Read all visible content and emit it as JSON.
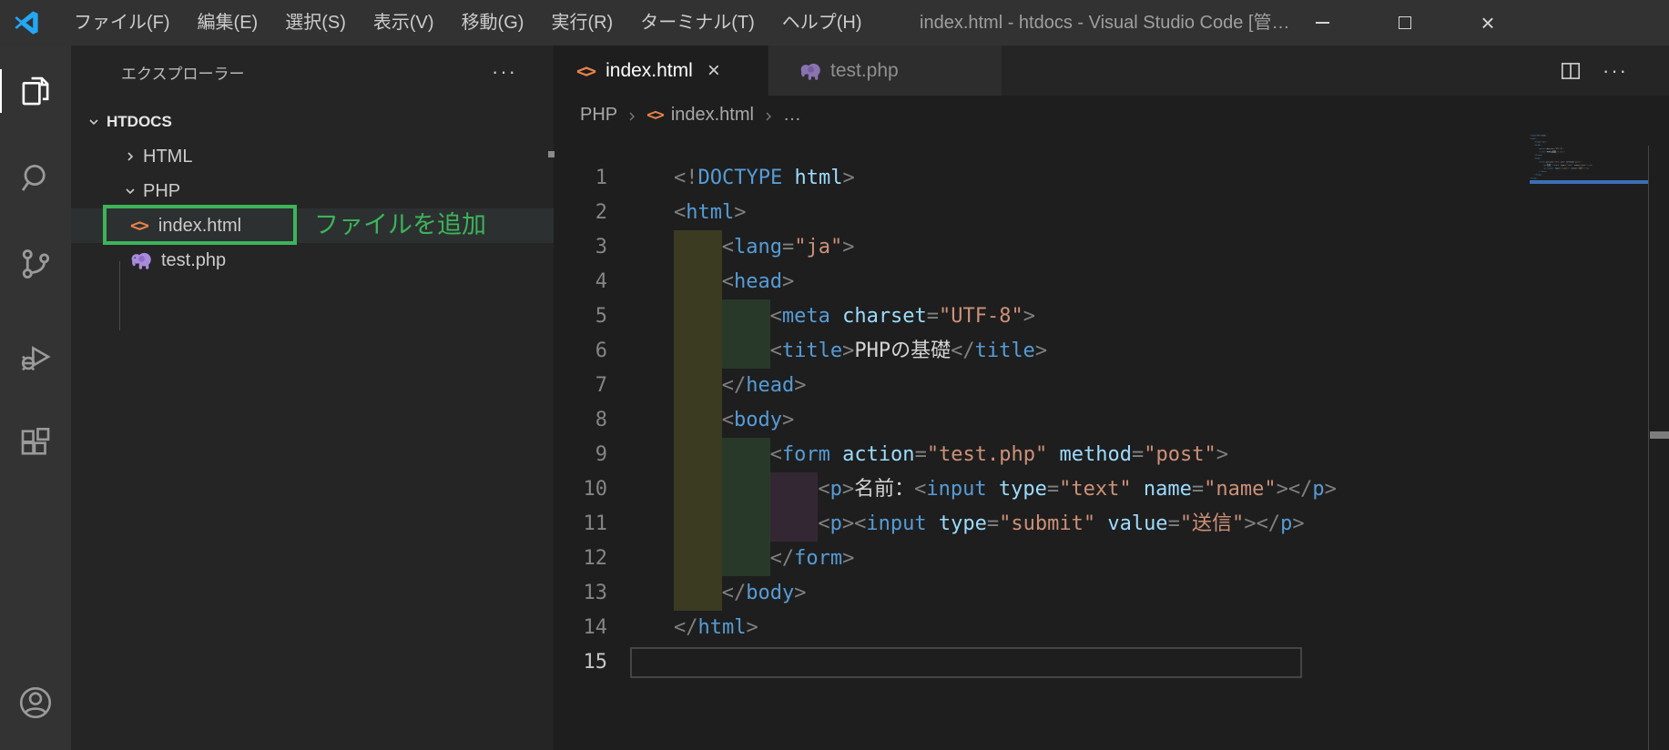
{
  "window": {
    "menus": [
      "ファイル(F)",
      "編集(E)",
      "選択(S)",
      "表示(V)",
      "移動(G)",
      "実行(R)",
      "ターミナル(T)",
      "ヘルプ(H)"
    ],
    "title": "index.html - htdocs - Visual Studio Code [管…",
    "controls": {
      "close": "×"
    }
  },
  "activity_bar": {
    "items": [
      "explorer",
      "search",
      "source-control",
      "run-and-debug",
      "extensions"
    ],
    "account": "accounts"
  },
  "sidebar": {
    "header": {
      "title": "エクスプローラー",
      "more": "···"
    },
    "tree": {
      "root": {
        "label": "HTDOCS"
      },
      "items": [
        {
          "label": "HTML",
          "type": "folder",
          "state": "collapsed"
        },
        {
          "label": "PHP",
          "type": "folder",
          "state": "expanded"
        },
        {
          "label": "index.html",
          "type": "file-html",
          "selected": true,
          "annotated": true
        },
        {
          "label": "test.php",
          "type": "file-php",
          "selected": false
        }
      ]
    },
    "annotation": {
      "label": "ファイルを追加",
      "color": "#3cb45a"
    }
  },
  "editor": {
    "tabs": [
      {
        "label": "index.html",
        "icon": "html",
        "active": true,
        "close": "×"
      },
      {
        "label": "test.php",
        "icon": "php",
        "active": false
      }
    ],
    "actions": {
      "more": "···"
    },
    "breadcrumb": {
      "folder": "PHP",
      "file": "index.html",
      "more": "…"
    },
    "code": {
      "language": "html",
      "colors": {
        "tag": "#569cd6",
        "attribute": "#9cdcfe",
        "string": "#ce9178",
        "text": "#d4d4d4",
        "punctuation": "#808080"
      },
      "lines": [
        {
          "n": 1,
          "indent": 0,
          "tokens": [
            [
              "p",
              "<!"
            ],
            [
              "t",
              "DOCTYPE"
            ],
            [
              "x",
              " "
            ],
            [
              "a",
              "html"
            ],
            [
              "p",
              ">"
            ]
          ]
        },
        {
          "n": 2,
          "indent": 0,
          "tokens": [
            [
              "p",
              "<"
            ],
            [
              "t",
              "html"
            ],
            [
              "p",
              ">"
            ]
          ]
        },
        {
          "n": 3,
          "indent": 1,
          "tokens": [
            [
              "p",
              "<"
            ],
            [
              "t",
              "lang"
            ],
            [
              "p",
              "="
            ],
            [
              "s",
              "\"ja\""
            ],
            [
              "p",
              ">"
            ]
          ]
        },
        {
          "n": 4,
          "indent": 1,
          "tokens": [
            [
              "p",
              "<"
            ],
            [
              "t",
              "head"
            ],
            [
              "p",
              ">"
            ]
          ]
        },
        {
          "n": 5,
          "indent": 2,
          "tokens": [
            [
              "p",
              "<"
            ],
            [
              "t",
              "meta"
            ],
            [
              "x",
              " "
            ],
            [
              "a",
              "charset"
            ],
            [
              "p",
              "="
            ],
            [
              "s",
              "\"UTF-8\""
            ],
            [
              "p",
              ">"
            ]
          ]
        },
        {
          "n": 6,
          "indent": 2,
          "tokens": [
            [
              "p",
              "<"
            ],
            [
              "t",
              "title"
            ],
            [
              "p",
              ">"
            ],
            [
              "x",
              "PHPの基礎"
            ],
            [
              "p",
              "</"
            ],
            [
              "t",
              "title"
            ],
            [
              "p",
              ">"
            ]
          ]
        },
        {
          "n": 7,
          "indent": 1,
          "tokens": [
            [
              "p",
              "</"
            ],
            [
              "t",
              "head"
            ],
            [
              "p",
              ">"
            ]
          ]
        },
        {
          "n": 8,
          "indent": 1,
          "tokens": [
            [
              "p",
              "<"
            ],
            [
              "t",
              "body"
            ],
            [
              "p",
              ">"
            ]
          ]
        },
        {
          "n": 9,
          "indent": 2,
          "tokens": [
            [
              "p",
              "<"
            ],
            [
              "t",
              "form"
            ],
            [
              "x",
              " "
            ],
            [
              "a",
              "action"
            ],
            [
              "p",
              "="
            ],
            [
              "s",
              "\"test.php\""
            ],
            [
              "x",
              " "
            ],
            [
              "a",
              "method"
            ],
            [
              "p",
              "="
            ],
            [
              "s",
              "\"post\""
            ],
            [
              "p",
              ">"
            ]
          ]
        },
        {
          "n": 10,
          "indent": 3,
          "tokens": [
            [
              "p",
              "<"
            ],
            [
              "t",
              "p"
            ],
            [
              "p",
              ">"
            ],
            [
              "x",
              "名前："
            ],
            [
              "p",
              "<"
            ],
            [
              "t",
              "input"
            ],
            [
              "x",
              " "
            ],
            [
              "a",
              "type"
            ],
            [
              "p",
              "="
            ],
            [
              "s",
              "\"text\""
            ],
            [
              "x",
              " "
            ],
            [
              "a",
              "name"
            ],
            [
              "p",
              "="
            ],
            [
              "s",
              "\"name\""
            ],
            [
              "p",
              ">"
            ],
            [
              "p",
              "</"
            ],
            [
              "t",
              "p"
            ],
            [
              "p",
              ">"
            ]
          ]
        },
        {
          "n": 11,
          "indent": 3,
          "tokens": [
            [
              "p",
              "<"
            ],
            [
              "t",
              "p"
            ],
            [
              "p",
              ">"
            ],
            [
              "p",
              "<"
            ],
            [
              "t",
              "input"
            ],
            [
              "x",
              " "
            ],
            [
              "a",
              "type"
            ],
            [
              "p",
              "="
            ],
            [
              "s",
              "\"submit\""
            ],
            [
              "x",
              " "
            ],
            [
              "a",
              "value"
            ],
            [
              "p",
              "="
            ],
            [
              "s",
              "\"送信\""
            ],
            [
              "p",
              ">"
            ],
            [
              "p",
              "</"
            ],
            [
              "t",
              "p"
            ],
            [
              "p",
              ">"
            ]
          ]
        },
        {
          "n": 12,
          "indent": 2,
          "tokens": [
            [
              "p",
              "</"
            ],
            [
              "t",
              "form"
            ],
            [
              "p",
              ">"
            ]
          ]
        },
        {
          "n": 13,
          "indent": 1,
          "tokens": [
            [
              "p",
              "</"
            ],
            [
              "t",
              "body"
            ],
            [
              "p",
              ">"
            ]
          ]
        },
        {
          "n": 14,
          "indent": 0,
          "tokens": [
            [
              "p",
              "</"
            ],
            [
              "t",
              "html"
            ],
            [
              "p",
              ">"
            ]
          ]
        },
        {
          "n": 15,
          "indent": 0,
          "tokens": [],
          "current": true
        }
      ]
    },
    "minimap": {
      "highlight_color": "#3a6fb5"
    }
  }
}
